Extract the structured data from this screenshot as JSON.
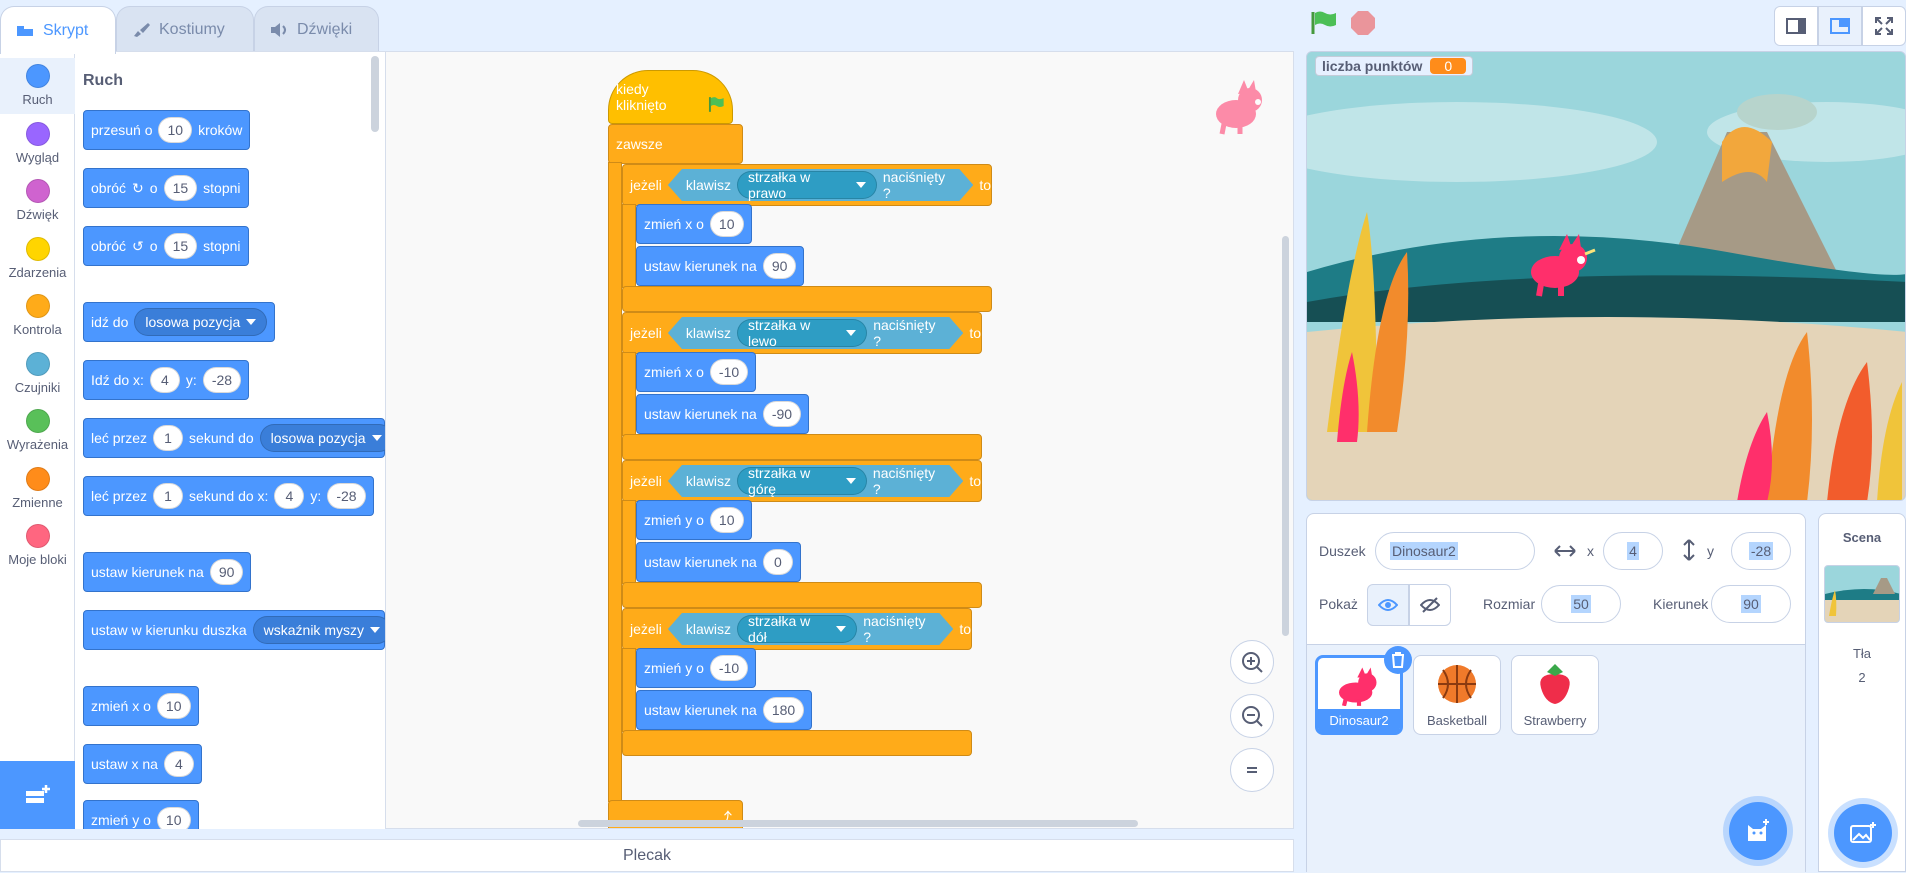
{
  "tabs": {
    "code": "Skrypt",
    "costumes": "Kostiumy",
    "sounds": "Dźwięki"
  },
  "categories": [
    {
      "label": "Ruch",
      "color": "#4c97ff"
    },
    {
      "label": "Wygląd",
      "color": "#9966ff"
    },
    {
      "label": "Dźwięk",
      "color": "#cf63cf"
    },
    {
      "label": "Zdarzenia",
      "color": "#ffd500"
    },
    {
      "label": "Kontrola",
      "color": "#ffab19"
    },
    {
      "label": "Czujniki",
      "color": "#5cb1d6"
    },
    {
      "label": "Wyrażenia",
      "color": "#59c059"
    },
    {
      "label": "Zmienne",
      "color": "#ff8c1a"
    },
    {
      "label": "Moje bloki",
      "color": "#ff6680"
    }
  ],
  "palette": {
    "heading": "Ruch",
    "move": {
      "a": "przesuń o",
      "v": "10",
      "b": "kroków"
    },
    "turn_right": {
      "a": "obróć",
      "b": "o",
      "v": "15",
      "c": "stopni"
    },
    "turn_left": {
      "a": "obróć",
      "b": "o",
      "v": "15",
      "c": "stopni"
    },
    "goto": {
      "a": "idź do",
      "dd": "losowa pozycja"
    },
    "goto_xy": {
      "a": "Idź do x:",
      "x": "4",
      "b": "y:",
      "y": "-28"
    },
    "glide": {
      "a": "leć przez",
      "v": "1",
      "b": "sekund do",
      "dd": "losowa pozycja"
    },
    "glide_xy": {
      "a": "leć przez",
      "v": "1",
      "b": "sekund do x:",
      "x": "4",
      "c": "y:",
      "y": "-28"
    },
    "point_dir": {
      "a": "ustaw kierunek na",
      "v": "90"
    },
    "point_towards": {
      "a": "ustaw w kierunku duszka",
      "dd": "wskaźnik myszy"
    },
    "change_x": {
      "a": "zmień x o",
      "v": "10"
    },
    "set_x": {
      "a": "ustaw x na",
      "v": "4"
    },
    "change_y": {
      "a": "zmień y o",
      "v": "10"
    }
  },
  "script": {
    "hat": "kiedy kliknięto",
    "forever": "zawsze",
    "if_label": "jeżeli",
    "then": "to",
    "key": "klawisz",
    "pressed": "naciśnięty ?",
    "branches": [
      {
        "key": "strzałka w prawo",
        "axis": "zmień x o",
        "delta": "10",
        "dir_label": "ustaw kierunek na",
        "dir": "90"
      },
      {
        "key": "strzałka w lewo",
        "axis": "zmień x o",
        "delta": "-10",
        "dir_label": "ustaw kierunek na",
        "dir": "-90"
      },
      {
        "key": "strzałka w górę",
        "axis": "zmień y o",
        "delta": "10",
        "dir_label": "ustaw kierunek na",
        "dir": "0"
      },
      {
        "key": "strzałka w dół",
        "axis": "zmień y o",
        "delta": "-10",
        "dir_label": "ustaw kierunek na",
        "dir": "180"
      }
    ]
  },
  "backpack": "Plecak",
  "stage": {
    "var_label": "liczba punktów",
    "var_value": "0"
  },
  "sprite_info": {
    "sprite_label": "Duszek",
    "name": "Dinosaur2",
    "x_label": "x",
    "x": "4",
    "y_label": "y",
    "y": "-28",
    "show_label": "Pokaż",
    "size_label": "Rozmiar",
    "size": "50",
    "dir_label": "Kierunek",
    "dir": "90"
  },
  "sprites": [
    {
      "name": "Dinosaur2"
    },
    {
      "name": "Basketball"
    },
    {
      "name": "Strawberry"
    }
  ],
  "stage_panel": {
    "title": "Scena",
    "backdrops_label": "Tła",
    "backdrops_count": "2"
  }
}
